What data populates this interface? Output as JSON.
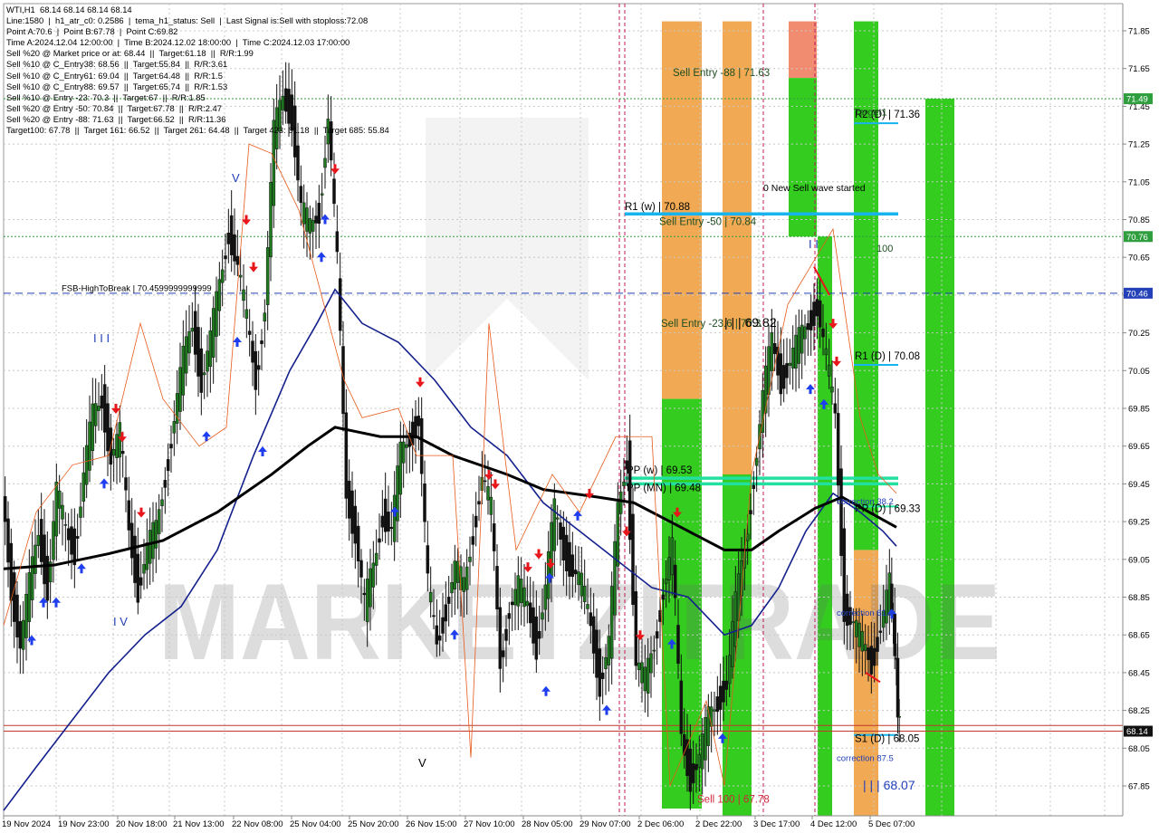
{
  "info_lines": [
    "WTI,H1  68.14 68.14 68.14 68.14",
    "Line:1580  |  h1_atr_c0: 0.2586  |  tema_h1_status: Sell  |  Last Signal is:Sell with stoploss:72.08",
    "Point A:70.6  |  Point B:67.78  |  Point C:69.82",
    "Time A:2024.12.04 12:00:00  |  Time B:2024.12.02 18:00:00  |  Time C:2024.12.03 17:00:00",
    "Sell %20 @ Market price or at: 68.44  ||  Target:61.18  ||  R/R:1.99",
    "Sell %10 @ C_Entry38: 68.56  ||  Target:55.84  ||  R/R:3.61",
    "Sell %10 @ C_Entry61: 69.04  ||  Target:64.48  ||  R/R:1.5",
    "Sell %10 @ C_Entry88: 69.57  ||  Target:65.74  ||  R/R:1.53",
    "Sell %10 @ Entry -23: 70.3  ||  Target:67  ||  R/R:1.85",
    "Sell %20 @ Entry -50: 70.84  ||  Target:67.78  ||  R/R:2.47",
    "Sell %20 @ Entry -88: 71.63  ||  Target:66.52  ||  R/R:11.36",
    "Target100: 67.78  ||  Target 161: 66.52  ||  Target 261: 64.48  ||  Target 423: 61.18  ||  Target 685: 55.84"
  ],
  "watermark": "MARKETZITRADE",
  "chart_data": {
    "type": "candlestick",
    "symbol": "WTI",
    "timeframe": "H1",
    "ylim": [
      67.6,
      71.9
    ],
    "y_ticks": [
      "71.85",
      "71.65",
      "71.45",
      "71.25",
      "71.05",
      "70.85",
      "70.65",
      "70.45",
      "70.25",
      "70.05",
      "69.85",
      "69.65",
      "69.45",
      "69.25",
      "69.05",
      "68.85",
      "68.65",
      "68.45",
      "68.25",
      "68.05",
      "67.85",
      "67.65"
    ],
    "x_ticks": [
      "19 Nov 2024",
      "19 Nov 23:00",
      "20 Nov 18:00",
      "21 Nov 13:00",
      "22 Nov 08:00",
      "25 Nov 04:00",
      "25 Nov 20:00",
      "26 Nov 15:00",
      "27 Nov 10:00",
      "28 Nov 05:00",
      "29 Nov 07:00",
      "2 Dec 06:00",
      "2 Dec 22:00",
      "3 Dec 17:00",
      "4 Dec 12:00",
      "5 Dec 07:00"
    ],
    "price_tags": [
      {
        "text": "71.49",
        "value": 71.49,
        "color": "#2e9e3e"
      },
      {
        "text": "70.76",
        "value": 70.76,
        "color": "#2e9e3e"
      },
      {
        "text": "70.46",
        "value": 70.46,
        "color": "#2340b8"
      },
      {
        "text": "68.14",
        "value": 68.14,
        "color": "#111111"
      }
    ],
    "horizontal_lines": [
      {
        "value": 71.49,
        "style": "dotted",
        "color": "#2e9e3e"
      },
      {
        "value": 70.76,
        "style": "dotted",
        "color": "#2e9e3e"
      },
      {
        "value": 70.46,
        "style": "dashed",
        "color": "#2340b8"
      },
      {
        "value": 68.17,
        "style": "solid",
        "color": "#c0392b"
      },
      {
        "value": 68.14,
        "style": "solid",
        "color": "#c0392b"
      }
    ],
    "levels": [
      {
        "label": "R1 (w) | 70.88",
        "value": 70.88,
        "color": "#16b3ee"
      },
      {
        "label": "PP (w) | 69.53",
        "value": 69.48,
        "color": "#22e0a0"
      },
      {
        "label": "PP (MN) | 69.48",
        "value": 69.45,
        "color": "#22e0a0"
      },
      {
        "label": "R2 (D) | 71.36",
        "value": 71.36,
        "color": "#16b3ee"
      },
      {
        "label": "R1 (D) | 70.08",
        "value": 70.08,
        "color": "#16b3ee"
      },
      {
        "label": "PP (D) | 69.33",
        "value": 69.33,
        "color": "#22e0a0"
      },
      {
        "label": "S1 (D) | 68.05",
        "value": 68.12,
        "color": "#16b3ee"
      }
    ],
    "annotations": [
      {
        "text": "Sell Entry -88 | 71.63",
        "value": 71.63,
        "color": "#1d4d20"
      },
      {
        "text": "Sell Entry -50 | 70.84",
        "value": 70.84,
        "color": "#1d4d20"
      },
      {
        "text": "Sell Entry -23.6 | 70.3",
        "value": 70.3,
        "color": "#1d4d20"
      },
      {
        "text": "Sell 100 | 67.78",
        "value": 67.78,
        "color": "#d0263a"
      },
      {
        "text": "0 New Sell wave started",
        "value": 71.02,
        "color": "#000000"
      },
      {
        "text": "Target1",
        "value": 71.42,
        "color": "#1d4d20"
      },
      {
        "text": "100",
        "value": 70.7,
        "color": "#1d4d20"
      },
      {
        "text": "| | | 69.82",
        "value": 70.3,
        "color": "#000000"
      },
      {
        "text": "| | | 68.07",
        "value": 67.85,
        "color": "#2340b8"
      },
      {
        "text": "correction 38.2",
        "value": 69.36,
        "color": "#2340b8"
      },
      {
        "text": "correction 61.8",
        "value": 68.77,
        "color": "#2340b8"
      },
      {
        "text": "correction 87.5",
        "value": 68.0,
        "color": "#2340b8"
      },
      {
        "text": "FSB-HighToBreak | 70.4599999999999",
        "value": 70.49,
        "color": "#000000"
      }
    ],
    "wave_labels": [
      {
        "text": "V",
        "value": 71.05,
        "color": "#2340b8"
      },
      {
        "text": "I I I",
        "value": 70.2,
        "color": "#2340b8"
      },
      {
        "text": "I V",
        "value": 68.7,
        "color": "#2340b8"
      },
      {
        "text": "V",
        "value": 67.95,
        "color": "#000000"
      },
      {
        "text": "I I",
        "value": 70.7,
        "color": "#2340b8"
      }
    ],
    "sell_zones": [
      {
        "color": "#f0a040",
        "top": 71.9,
        "bottom": 69.9
      },
      {
        "color": "#f0a040",
        "top": 71.9,
        "bottom": 67.6
      },
      {
        "color": "#f08060",
        "top": 71.9,
        "bottom": 71.6
      },
      {
        "color": "#f0a040",
        "top": 69.1,
        "bottom": 67.6
      }
    ],
    "buy_zones": [
      {
        "color": "#33cc1f",
        "top": 69.9,
        "bottom": 67.73
      },
      {
        "color": "#33cc1f",
        "top": 69.5,
        "bottom": 67.6
      },
      {
        "color": "#33cc1f",
        "top": 71.6,
        "bottom": 70.76
      },
      {
        "color": "#33cc1f",
        "top": 70.76,
        "bottom": 67.6
      },
      {
        "color": "#33cc1f",
        "top": 71.9,
        "bottom": 69.1
      },
      {
        "color": "#33cc1f",
        "top": 71.49,
        "bottom": 67.6
      }
    ]
  }
}
